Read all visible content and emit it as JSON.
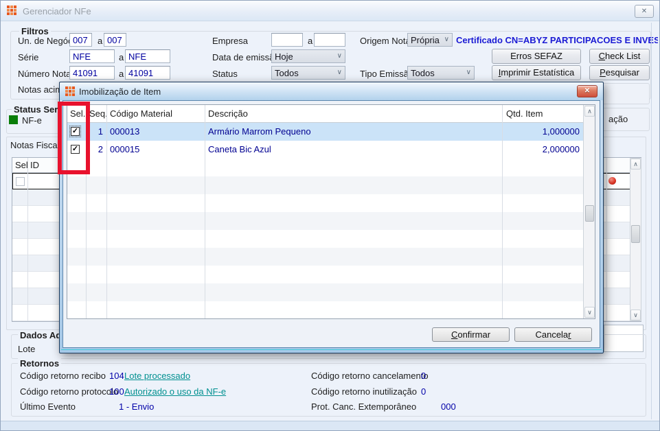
{
  "window": {
    "title": "Gerenciador NFe"
  },
  "icons": {
    "close": "✕",
    "dropdown": "∨",
    "scroll_up": "∧",
    "scroll_down": "∨",
    "check": "✓"
  },
  "colors": {
    "annotation_red": "#e8112d",
    "legend_green": "#0a7e0a",
    "link_teal": "#009090",
    "value_navy": "#0000a0",
    "cert_blue": "#1b1bd4",
    "row_highlight": "#cbe3f8"
  },
  "filters": {
    "group_label": "Filtros",
    "un_negocio": {
      "label": "Un. de Negócio",
      "from": "007",
      "sep": "a",
      "to": "007"
    },
    "serie": {
      "label": "Série",
      "from": "NFE",
      "sep": "a",
      "to": "NFE"
    },
    "numero_nota": {
      "label": "Número Nota",
      "from": "41091",
      "sep": "a",
      "to": "41091"
    },
    "notas_acima_label": "Notas acima",
    "empresa": {
      "label": "Empresa",
      "from": "",
      "sep": "a",
      "to": ""
    },
    "data_emissao": {
      "label": "Data de emissão",
      "value": "Hoje"
    },
    "status": {
      "label": "Status",
      "value": "Todos"
    },
    "origem_nota": {
      "label": "Origem Nota",
      "value": "Própria"
    },
    "tipo_emissao": {
      "label": "Tipo Emissão",
      "value": "Todos"
    },
    "certificado": "Certificado CN=ABYZ PARTICIPACOES E INVEST",
    "buttons": {
      "erros_sefaz": "Erros SEFAZ",
      "check_list": {
        "pre": "",
        "key": "C",
        "post": "heck List"
      },
      "imprimir_estatistica": {
        "pre": "",
        "key": "I",
        "post": "mprimir Estatística"
      },
      "pesquisar": {
        "pre": "",
        "key": "P",
        "post": "esquisar"
      }
    }
  },
  "status_servico": {
    "group_label": "Status Ser",
    "legend_nfe": "NF-e"
  },
  "notas_fiscais": {
    "panel_label": "Notas Fiscais",
    "col_sel": "Sel",
    "col_id": "ID",
    "right_partial_label": "ação"
  },
  "dados_adicionais": {
    "group_label": "Dados Ad",
    "lote_label": "Lote"
  },
  "retornos": {
    "group_label": "Retornos",
    "recibo": {
      "label": "Código retorno recibo",
      "code": "104",
      "link": "Lote processado"
    },
    "protocolo": {
      "label": "Código retorno protocolo",
      "code": "100",
      "link": "Autorizado o uso da NF-e"
    },
    "ultimo_evento": {
      "label": "Último Evento",
      "value": "1 - Envio"
    },
    "cancelamento": {
      "label": "Código retorno cancelamento",
      "value": "0"
    },
    "inutilizacao": {
      "label": "Código retorno inutilização",
      "value": "0"
    },
    "prot_canc": {
      "label": "Prot. Canc. Extemporâneo",
      "value": "000"
    }
  },
  "dialog": {
    "title": "Imobilização de Item",
    "columns": {
      "sel": "Sel.",
      "seq": "Seq.",
      "codigo": "Código Material",
      "descricao": "Descrição",
      "qtd": "Qtd. Item"
    },
    "rows": [
      {
        "seq": "1",
        "codigo": "000013",
        "descricao": "Armário Marrom Pequeno",
        "qtd": "1,000000"
      },
      {
        "seq": "2",
        "codigo": "000015",
        "descricao": "Caneta Bic Azul",
        "qtd": "2,000000"
      }
    ],
    "buttons": {
      "confirmar": {
        "pre": "",
        "key": "C",
        "post": "onfirmar"
      },
      "cancelar": {
        "pre": "Cancela",
        "key": "r",
        "post": ""
      }
    }
  }
}
